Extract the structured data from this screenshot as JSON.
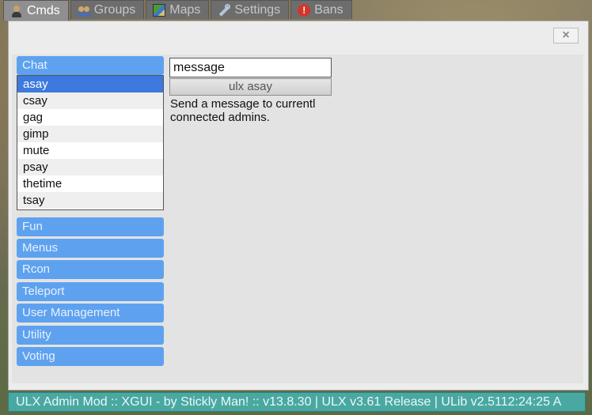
{
  "tabs": [
    {
      "label": "Cmds",
      "icon": "person-icon",
      "active": true
    },
    {
      "label": "Groups",
      "icon": "group-icon"
    },
    {
      "label": "Maps",
      "icon": "map-icon"
    },
    {
      "label": "Settings",
      "icon": "wrench-icon"
    },
    {
      "label": "Bans",
      "icon": "ban-icon"
    }
  ],
  "panel": {
    "close_label": "×"
  },
  "categories": {
    "open": {
      "label": "Chat",
      "commands": [
        "asay",
        "csay",
        "gag",
        "gimp",
        "mute",
        "psay",
        "thetime",
        "tsay"
      ],
      "selected": "asay"
    },
    "collapsed": [
      "Fun",
      "Menus",
      "Rcon",
      "Teleport",
      "User Management",
      "Utility",
      "Voting"
    ]
  },
  "command_panel": {
    "arg_value": "message",
    "run_label": "ulx asay",
    "help_line1": "Send a message to currentl",
    "help_line2": "connected admins."
  },
  "status": {
    "text": "ULX Admin Mod :: XGUI - by Stickly Man! :: v13.8.30 |  ULX v3.61 Release  |  ULib v2.5112:24:25 A"
  },
  "colors": {
    "category_blue": "#5ea2ef",
    "selection_blue": "#3d79de",
    "status_teal": "#4aa8a2"
  }
}
